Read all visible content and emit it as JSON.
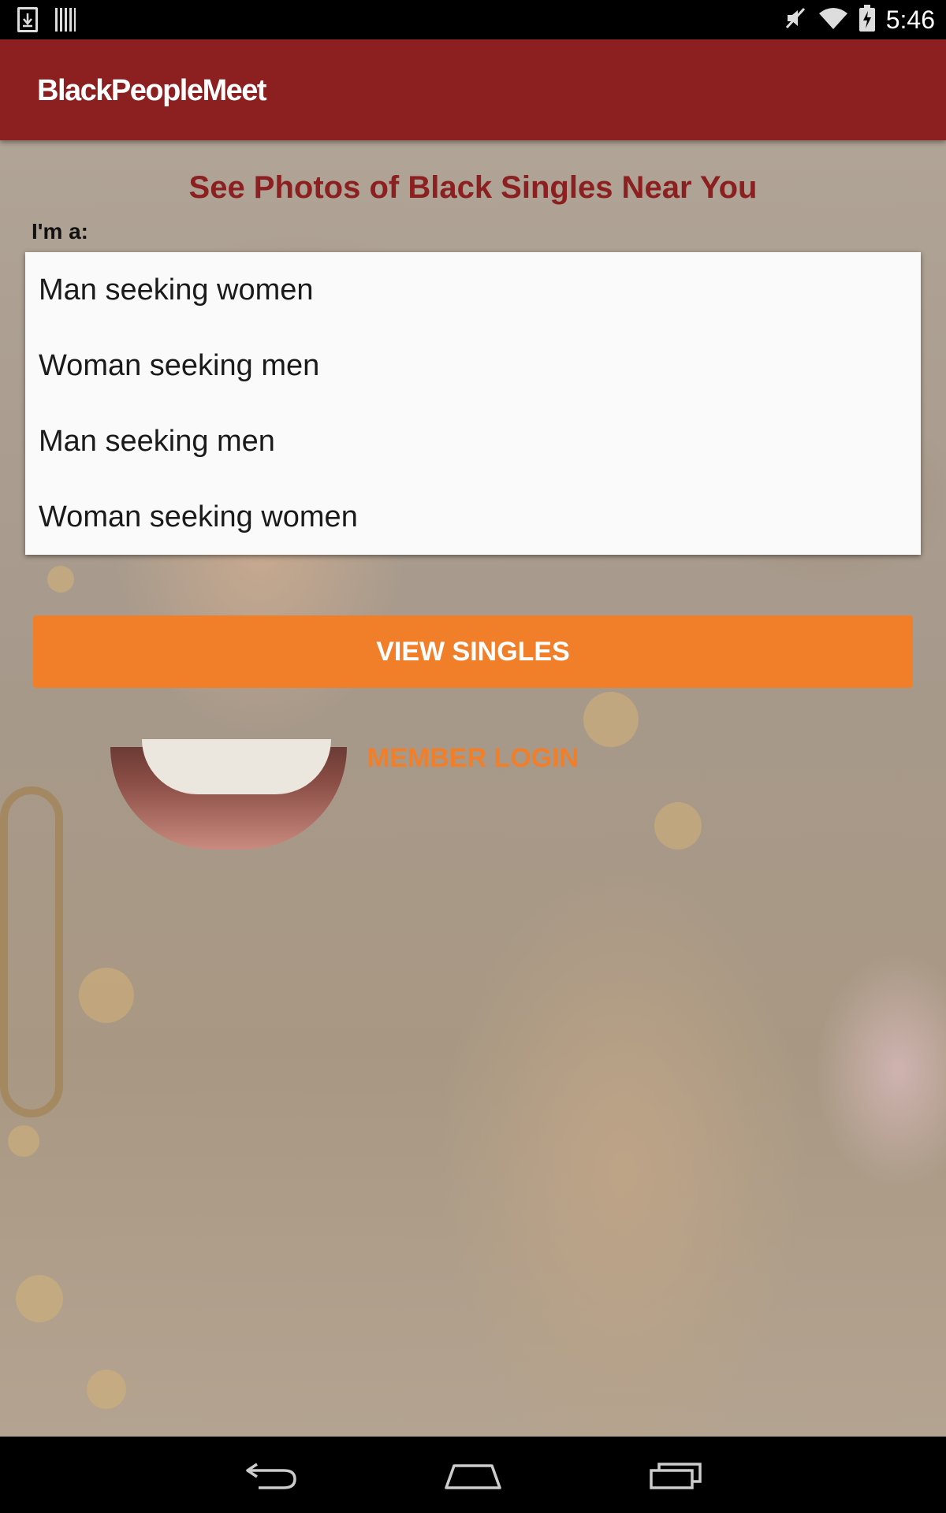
{
  "status_bar": {
    "time": "5:46",
    "left_icons": [
      "download-icon",
      "barcode-icon"
    ],
    "right_icons": [
      "mute-icon",
      "wifi-icon",
      "battery-charging-icon"
    ]
  },
  "app_bar": {
    "logo_text": "BlackPeopleMeet",
    "color": "#8c1f20"
  },
  "main": {
    "headline": "See Photos of Black Singles Near You",
    "im_label": "I'm a:",
    "options": [
      "Man seeking women",
      "Woman seeking men",
      "Man seeking men",
      "Woman seeking women"
    ],
    "view_singles_label": "VIEW SINGLES",
    "member_login_label": "MEMBER LOGIN",
    "accent_color": "#f17f2a"
  },
  "nav_bar": {
    "icons": [
      "back-icon",
      "home-icon",
      "recents-icon"
    ]
  }
}
